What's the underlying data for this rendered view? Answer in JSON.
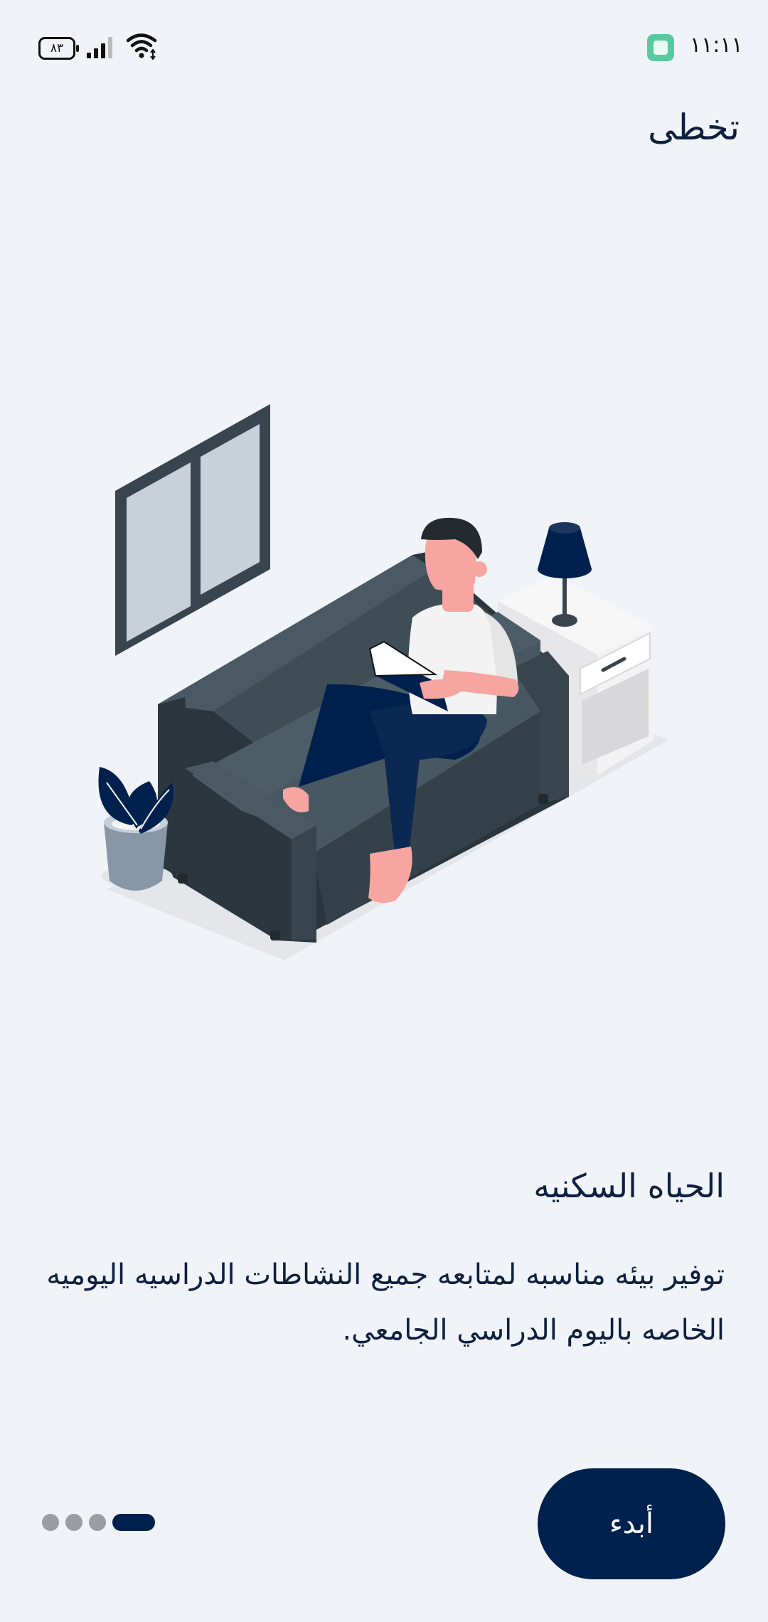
{
  "status_bar": {
    "battery": "٨٣",
    "time": "١١:١١",
    "icons": [
      "battery-icon",
      "signal-icon",
      "wifi-icon",
      "app-notification-icon"
    ]
  },
  "skip_label": "تخطى",
  "illustration": {
    "icon": "person-on-sofa-illustration"
  },
  "title": "الحياه السكنيه",
  "description": "توفير بيئه مناسبه لمتابعه جميع النشاطات الدراسيه اليوميه الخاصه باليوم الدراسي الجامعي.",
  "pagination": {
    "count": 4,
    "active_index": 3
  },
  "start_button_label": "أبدء",
  "colors": {
    "primary": "#00214e",
    "background": "#f0f3f8",
    "dot_inactive": "#9a9da3",
    "skin": "#f6a5a0",
    "sofa": "#3c4a54"
  }
}
